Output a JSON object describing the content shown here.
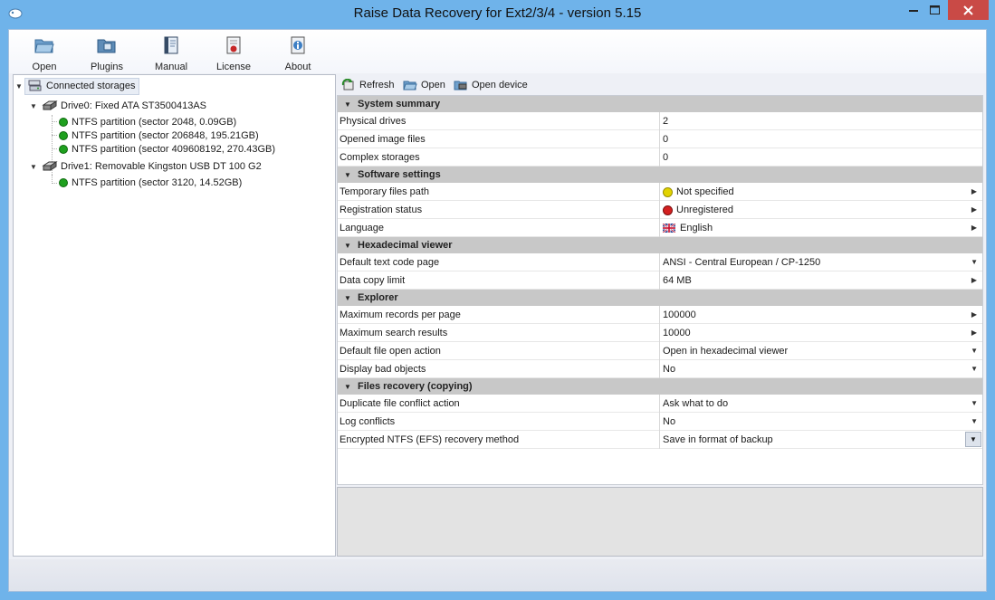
{
  "window": {
    "title": "Raise Data Recovery for Ext2/3/4 - version 5.15",
    "titlebar_color": "#6fb3ea",
    "close_color": "#c94a46"
  },
  "toolbar": {
    "items": [
      {
        "label": "Open",
        "icon": "folder-open-icon"
      },
      {
        "label": "Plugins",
        "icon": "plugins-icon"
      },
      {
        "label": "Manual",
        "icon": "manual-book-icon"
      },
      {
        "label": "License",
        "icon": "license-icon"
      },
      {
        "label": "About",
        "icon": "about-icon"
      }
    ]
  },
  "tree": {
    "root": "Connected storages",
    "drives": [
      {
        "label": "Drive0: Fixed ATA ST3500413AS",
        "partitions": [
          "NTFS partition (sector 2048, 0.09GB)",
          "NTFS partition (sector 206848, 195.21GB)",
          "NTFS partition (sector 409608192, 270.43GB)"
        ]
      },
      {
        "label": "Drive1: Removable Kingston USB DT 100 G2",
        "partitions": [
          "NTFS partition (sector 3120, 14.52GB)"
        ]
      }
    ]
  },
  "right_toolbar": {
    "refresh": "Refresh",
    "open": "Open",
    "open_device": "Open device"
  },
  "properties": {
    "system_summary": {
      "title": "System summary",
      "rows": [
        {
          "name": "Physical drives",
          "value": "2"
        },
        {
          "name": "Opened image files",
          "value": "0"
        },
        {
          "name": "Complex storages",
          "value": "0"
        }
      ]
    },
    "software_settings": {
      "title": "Software settings",
      "rows": [
        {
          "name": "Temporary files path",
          "value": "Not specified",
          "status": "yellow"
        },
        {
          "name": "Registration status",
          "value": "Unregistered",
          "status": "red"
        },
        {
          "name": "Language",
          "value": "English",
          "status": "flag"
        }
      ]
    },
    "hex_viewer": {
      "title": "Hexadecimal viewer",
      "rows": [
        {
          "name": "Default text code page",
          "value": "ANSI - Central European / CP-1250"
        },
        {
          "name": "Data copy limit",
          "value": "64 MB"
        }
      ]
    },
    "explorer": {
      "title": "Explorer",
      "rows": [
        {
          "name": "Maximum records per page",
          "value": "100000"
        },
        {
          "name": "Maximum search results",
          "value": "10000"
        },
        {
          "name": "Default file open action",
          "value": "Open in hexadecimal viewer"
        },
        {
          "name": "Display bad objects",
          "value": "No"
        }
      ]
    },
    "files_recovery": {
      "title": "Files recovery (copying)",
      "rows": [
        {
          "name": "Duplicate file conflict action",
          "value": "Ask what to do"
        },
        {
          "name": "Log conflicts",
          "value": "No"
        },
        {
          "name": "Encrypted NTFS (EFS) recovery method",
          "value": "Save in format of backup"
        }
      ]
    }
  }
}
